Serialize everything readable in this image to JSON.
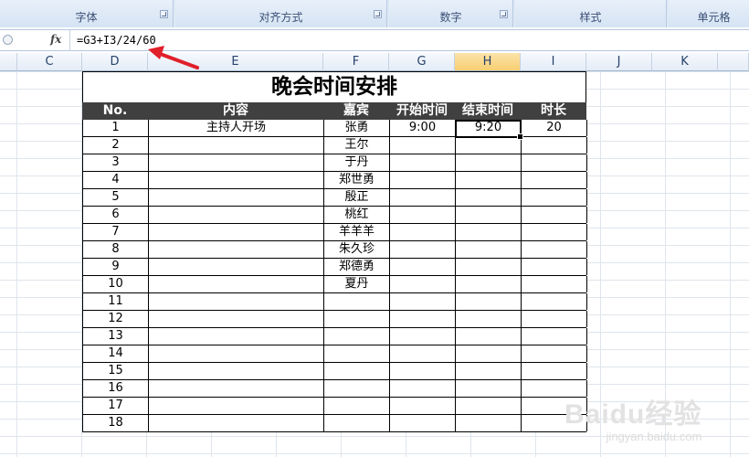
{
  "ribbon": {
    "groups": [
      {
        "label": "字体"
      },
      {
        "label": "对齐方式"
      },
      {
        "label": "数字"
      },
      {
        "label": "样式"
      },
      {
        "label": "单元格"
      }
    ]
  },
  "formula_bar": {
    "fx_label": "fx",
    "formula": "=G3+I3/24/60"
  },
  "columns": [
    "C",
    "D",
    "E",
    "F",
    "G",
    "H",
    "I",
    "J",
    "K"
  ],
  "active_column": "H",
  "table": {
    "title": "晚会时间安排",
    "headers": {
      "no": "No.",
      "content": "内容",
      "guest": "嘉宾",
      "start": "开始时间",
      "end": "结束时间",
      "duration": "时长"
    },
    "rows": [
      {
        "no": "1",
        "content": "主持人开场",
        "guest": "张勇",
        "start": "9:00",
        "end": "9:20",
        "duration": "20"
      },
      {
        "no": "2",
        "content": "",
        "guest": "王尔",
        "start": "",
        "end": "",
        "duration": ""
      },
      {
        "no": "3",
        "content": "",
        "guest": "于丹",
        "start": "",
        "end": "",
        "duration": ""
      },
      {
        "no": "4",
        "content": "",
        "guest": "郑世勇",
        "start": "",
        "end": "",
        "duration": ""
      },
      {
        "no": "5",
        "content": "",
        "guest": "殷正",
        "start": "",
        "end": "",
        "duration": ""
      },
      {
        "no": "6",
        "content": "",
        "guest": "桃红",
        "start": "",
        "end": "",
        "duration": ""
      },
      {
        "no": "7",
        "content": "",
        "guest": "羊羊羊",
        "start": "",
        "end": "",
        "duration": ""
      },
      {
        "no": "8",
        "content": "",
        "guest": "朱久珍",
        "start": "",
        "end": "",
        "duration": ""
      },
      {
        "no": "9",
        "content": "",
        "guest": "郑德勇",
        "start": "",
        "end": "",
        "duration": ""
      },
      {
        "no": "10",
        "content": "",
        "guest": "夏丹",
        "start": "",
        "end": "",
        "duration": ""
      },
      {
        "no": "11",
        "content": "",
        "guest": "",
        "start": "",
        "end": "",
        "duration": ""
      },
      {
        "no": "12",
        "content": "",
        "guest": "",
        "start": "",
        "end": "",
        "duration": ""
      },
      {
        "no": "13",
        "content": "",
        "guest": "",
        "start": "",
        "end": "",
        "duration": ""
      },
      {
        "no": "14",
        "content": "",
        "guest": "",
        "start": "",
        "end": "",
        "duration": ""
      },
      {
        "no": "15",
        "content": "",
        "guest": "",
        "start": "",
        "end": "",
        "duration": ""
      },
      {
        "no": "16",
        "content": "",
        "guest": "",
        "start": "",
        "end": "",
        "duration": ""
      },
      {
        "no": "17",
        "content": "",
        "guest": "",
        "start": "",
        "end": "",
        "duration": ""
      },
      {
        "no": "18",
        "content": "",
        "guest": "",
        "start": "",
        "end": "",
        "duration": ""
      }
    ]
  },
  "watermark": {
    "logo": "Baidu经验",
    "url": "jingyan.baidu.com"
  },
  "colors": {
    "header_bg": "#404040",
    "header_text": "#ffffff",
    "active_column": "#f8cf72",
    "arrow": "#e0202a"
  }
}
